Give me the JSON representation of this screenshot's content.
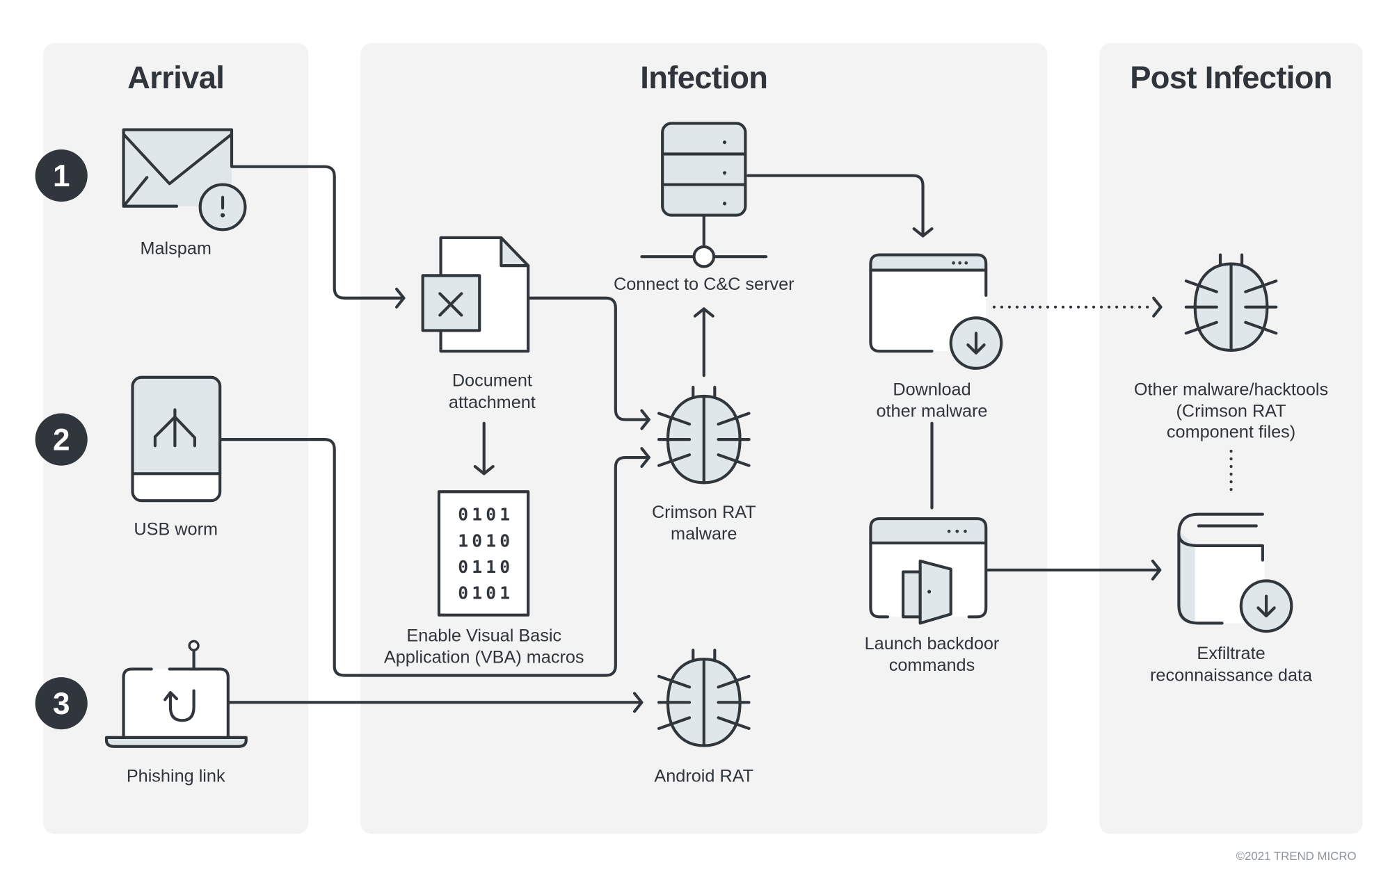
{
  "stages": {
    "arrival": {
      "title": "Arrival"
    },
    "infection": {
      "title": "Infection"
    },
    "post_infection": {
      "title": "Post Infection"
    }
  },
  "steps": [
    {
      "number": "1",
      "label": "Malspam",
      "icon": "envelope-alert-icon"
    },
    {
      "number": "2",
      "label": "USB worm",
      "icon": "usb-drive-icon"
    },
    {
      "number": "3",
      "label": "Phishing link",
      "icon": "laptop-hook-icon"
    }
  ],
  "nodes": {
    "document": {
      "line1": "Document",
      "line2": "attachment",
      "icon": "document-x-icon"
    },
    "vba": {
      "line1": "Enable Visual Basic",
      "line2": "Application (VBA) macros",
      "icon": "binary-file-icon",
      "binary_rows": [
        "0101",
        "1010",
        "0110",
        "0101"
      ]
    },
    "cnc": {
      "label": "Connect to C&C server",
      "icon": "server-icon"
    },
    "crimson": {
      "line1": "Crimson RAT",
      "line2": "malware",
      "icon": "bug-icon"
    },
    "android": {
      "label": "Android RAT",
      "icon": "bug-icon"
    },
    "download": {
      "line1": "Download",
      "line2": "other malware",
      "icon": "browser-download-icon"
    },
    "backdoor": {
      "line1": "Launch backdoor",
      "line2": "commands",
      "icon": "browser-door-icon"
    },
    "other_malware": {
      "line1": "Other malware/hacktools",
      "line2": "(Crimson RAT",
      "line3": "component files)",
      "icon": "bug-icon"
    },
    "exfiltrate": {
      "line1": "Exfiltrate",
      "line2": "reconnaissance data",
      "icon": "book-download-icon"
    }
  },
  "footer": {
    "copyright": "©2021 TREND MICRO"
  },
  "colors": {
    "ink": "#30363b",
    "panel": "#f3f3f3",
    "icon_fill": "#e0e7ea"
  }
}
